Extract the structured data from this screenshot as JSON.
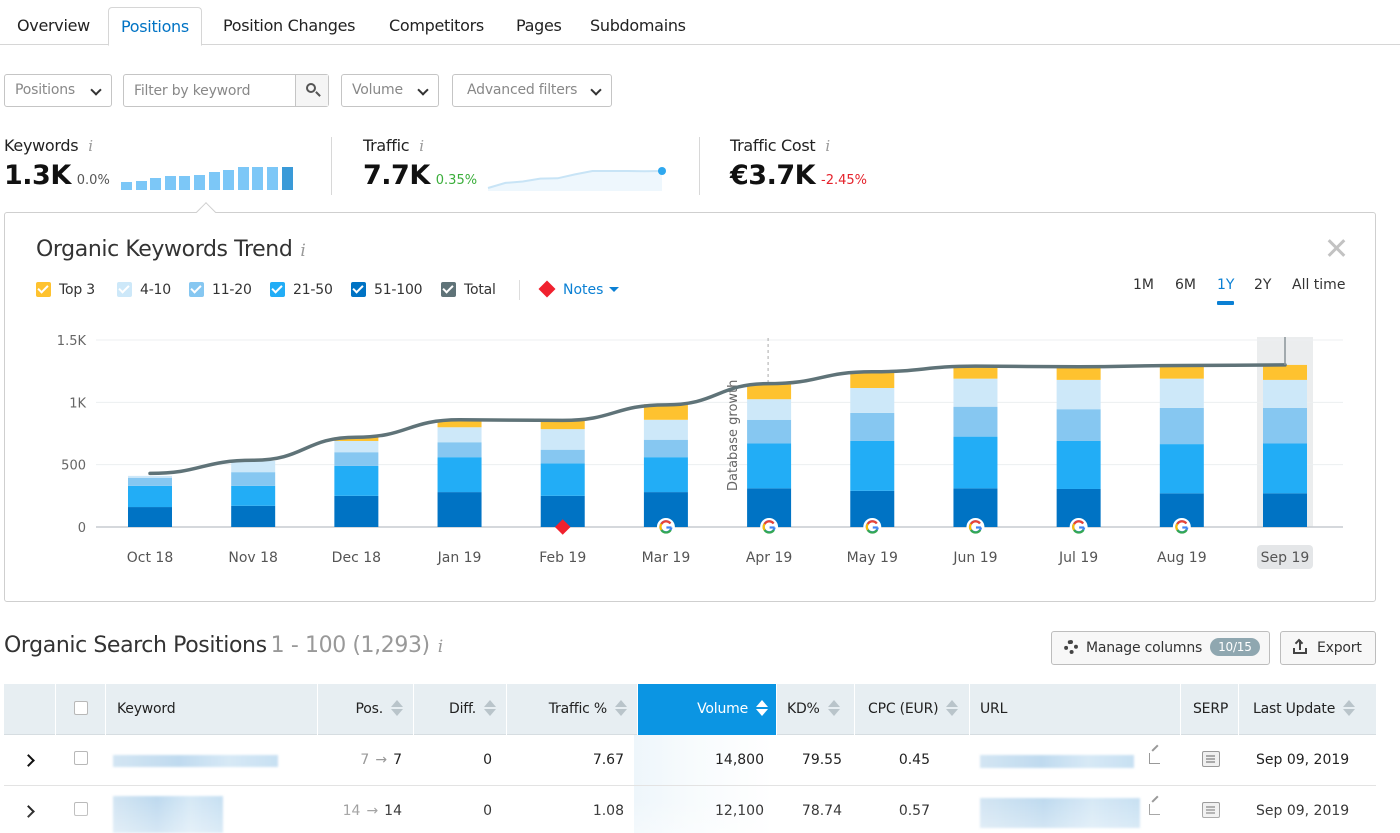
{
  "tabs": [
    {
      "label": "Overview",
      "active": false
    },
    {
      "label": "Positions",
      "active": true
    },
    {
      "label": "Position Changes",
      "active": false
    },
    {
      "label": "Competitors",
      "active": false
    },
    {
      "label": "Pages",
      "active": false
    },
    {
      "label": "Subdomains",
      "active": false
    }
  ],
  "filters": {
    "positions_label": "Positions",
    "keyword_placeholder": "Filter by keyword",
    "keyword_value": "",
    "volume_label": "Volume",
    "advanced_label": "Advanced filters"
  },
  "metrics": {
    "keywords": {
      "label": "Keywords",
      "value": "1.3K",
      "delta": "0.0%",
      "sparkline": [
        0.2,
        0.28,
        0.42,
        0.52,
        0.52,
        0.6,
        0.75,
        0.85,
        1.0,
        1.0,
        1.0,
        1.0
      ]
    },
    "traffic": {
      "label": "Traffic",
      "value": "7.7K",
      "delta": "0.35%",
      "sparkline": [
        0.0,
        0.3,
        0.38,
        0.55,
        0.57,
        0.8,
        1.0,
        1.0,
        1.0,
        0.98,
        1.0
      ]
    },
    "traffic_cost": {
      "label": "Traffic Cost",
      "value": "€3.7K",
      "delta": "-2.45%"
    }
  },
  "colors": {
    "top3": "#fec22f",
    "r4_10": "#cde8f9",
    "r11_20": "#86c7f1",
    "r21_50": "#22adf6",
    "r51_100": "#0073c4",
    "total": "#5f7378",
    "positive": "#3bae3b",
    "negative": "#e5222b",
    "accent": "#0b80d4"
  },
  "trend": {
    "title": "Organic Keywords Trend",
    "legend": [
      {
        "key": "top3",
        "label": "Top 3",
        "checked": true
      },
      {
        "key": "r4_10",
        "label": "4-10",
        "checked": true
      },
      {
        "key": "r11_20",
        "label": "11-20",
        "checked": true
      },
      {
        "key": "r21_50",
        "label": "21-50",
        "checked": true
      },
      {
        "key": "r51_100",
        "label": "51-100",
        "checked": true
      },
      {
        "key": "total",
        "label": "Total",
        "checked": true
      }
    ],
    "notes_label": "Notes",
    "ranges": [
      {
        "label": "1M",
        "active": false
      },
      {
        "label": "6M",
        "active": false
      },
      {
        "label": "1Y",
        "active": true
      },
      {
        "label": "2Y",
        "active": false
      },
      {
        "label": "All time",
        "active": false
      }
    ]
  },
  "chart_data": {
    "type": "bar",
    "stacked": true,
    "title": "Organic Keywords Trend",
    "categories": [
      "Oct 18",
      "Nov 18",
      "Dec 18",
      "Jan 19",
      "Feb 19",
      "Mar 19",
      "Apr 19",
      "May 19",
      "Jun 19",
      "Jul 19",
      "Aug 19",
      "Sep 19"
    ],
    "series": [
      {
        "name": "51-100",
        "key": "r51_100",
        "values": [
          160,
          170,
          250,
          280,
          250,
          280,
          310,
          290,
          310,
          305,
          270,
          270
        ]
      },
      {
        "name": "21-50",
        "key": "r21_50",
        "values": [
          170,
          160,
          240,
          280,
          260,
          280,
          360,
          400,
          415,
          385,
          395,
          400
        ]
      },
      {
        "name": "11-20",
        "key": "r11_20",
        "values": [
          65,
          110,
          110,
          120,
          110,
          140,
          190,
          225,
          240,
          255,
          290,
          285
        ]
      },
      {
        "name": "4-10",
        "key": "r4_10",
        "values": [
          15,
          90,
          90,
          120,
          165,
          160,
          165,
          200,
          225,
          235,
          235,
          225
        ]
      },
      {
        "name": "Top 3",
        "key": "top3",
        "values": [
          0,
          0,
          30,
          55,
          70,
          125,
          120,
          125,
          100,
          105,
          105,
          120
        ]
      }
    ],
    "line": {
      "name": "Total",
      "key": "total",
      "values": [
        430,
        535,
        720,
        860,
        855,
        980,
        1150,
        1245,
        1290,
        1285,
        1295,
        1300
      ]
    },
    "yticks": [
      "0",
      "500",
      "1K",
      "1.5K"
    ],
    "ytick_values": [
      0,
      500,
      1000,
      1500
    ],
    "ylim": [
      0,
      1500
    ],
    "xlabel": "",
    "ylabel": "",
    "grid": true,
    "annotations": [
      {
        "type": "vertical-line",
        "after_category": "Apr 19",
        "label": "Database growth"
      }
    ],
    "markers": {
      "note": [
        "Feb 19"
      ],
      "google_update": [
        "Mar 19",
        "Apr 19",
        "May 19",
        "Jun 19",
        "Jul 19",
        "Aug 19"
      ]
    },
    "highlighted_category": "Sep 19"
  },
  "positions": {
    "title": "Organic Search Positions",
    "range": "1 - 100 (1,293)",
    "manage_columns_label": "Manage columns",
    "manage_columns_badge": "10/15",
    "export_label": "Export",
    "columns": [
      "Keyword",
      "Pos.",
      "Diff.",
      "Traffic %",
      "Volume",
      "KD%",
      "CPC (EUR)",
      "URL",
      "SERP",
      "Last Update"
    ],
    "sorted_column": "Volume",
    "rows": [
      {
        "pos_prev": "7",
        "pos": "7",
        "diff": "0",
        "traffic": "7.67",
        "volume": "14,800",
        "kd": "79.55",
        "cpc": "0.45",
        "last_update": "Sep 09, 2019"
      },
      {
        "pos_prev": "14",
        "pos": "14",
        "diff": "0",
        "traffic": "1.08",
        "volume": "12,100",
        "kd": "78.74",
        "cpc": "0.57",
        "last_update": "Sep 09, 2019"
      }
    ]
  }
}
